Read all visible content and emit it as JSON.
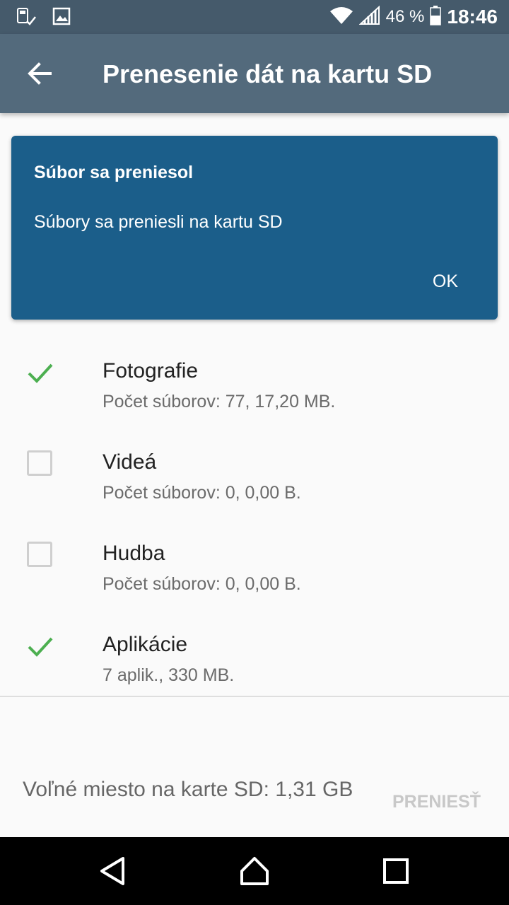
{
  "status_bar": {
    "battery_percent": "46 %",
    "time": "18:46",
    "icons": [
      "sd-card-icon",
      "image-icon",
      "wifi-icon",
      "signal-icon",
      "battery-icon"
    ]
  },
  "app_bar": {
    "title": "Prenesenie dát na kartu SD",
    "back_icon": "arrow-back-icon"
  },
  "dialog": {
    "title": "Súbor sa preniesol",
    "message": "Súbory sa preniesli na kartu SD",
    "ok_label": "OK"
  },
  "items": [
    {
      "title": "Fotografie",
      "subtitle": "Počet súborov: 77, 17,20 MB.",
      "checked": true
    },
    {
      "title": "Videá",
      "subtitle": "Počet súborov: 0, 0,00 B.",
      "checked": false
    },
    {
      "title": "Hudba",
      "subtitle": "Počet súborov: 0, 0,00 B.",
      "checked": false
    },
    {
      "title": "Aplikácie",
      "subtitle": "7 aplik., 330 MB.",
      "checked": true
    }
  ],
  "footer": {
    "free_space": "Voľné miesto na karte SD: 1,31 GB",
    "transfer_label": "PRENIESŤ"
  },
  "colors": {
    "status_bar": "#455a6b",
    "app_bar": "#536a7c",
    "dialog": "#1b5e8a",
    "check": "#4caf50"
  }
}
